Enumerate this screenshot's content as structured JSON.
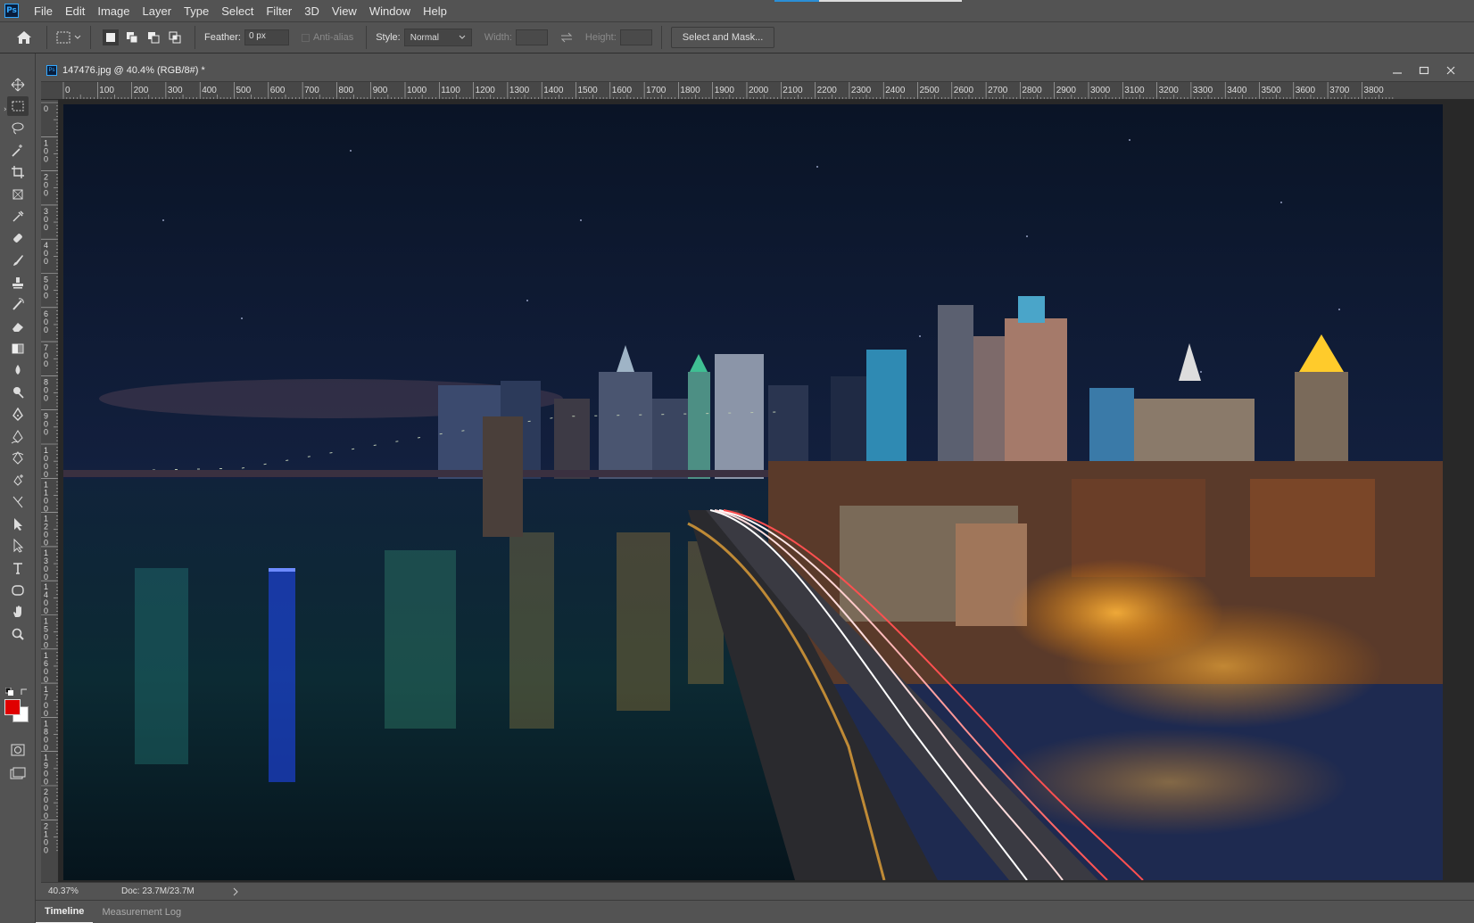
{
  "menubar": {
    "logo": "Ps",
    "items": [
      "File",
      "Edit",
      "Image",
      "Layer",
      "Type",
      "Select",
      "Filter",
      "3D",
      "View",
      "Window",
      "Help"
    ]
  },
  "options": {
    "feather_label": "Feather:",
    "feather_value": "0 px",
    "antialias_label": "Anti-alias",
    "style_label": "Style:",
    "style_value": "Normal",
    "width_label": "Width:",
    "height_label": "Height:",
    "select_mask_label": "Select and Mask..."
  },
  "tools": [
    "move-tool-icon",
    "rect-marquee-icon",
    "lasso-icon",
    "magic-wand-icon",
    "crop-icon",
    "frame-icon",
    "eyedropper-icon",
    "healing-brush-icon",
    "brush-icon",
    "clone-stamp-icon",
    "history-brush-icon",
    "eraser-icon",
    "gradient-icon",
    "blur-icon",
    "dodge-icon",
    "pen-icon",
    "freeform-pen-icon",
    "curvature-pen-icon",
    "add-anchor-icon",
    "convert-point-icon",
    "path-selection-icon",
    "direct-selection-icon",
    "type-icon",
    "shape-icon",
    "hand-icon",
    "zoom-icon"
  ],
  "colors": {
    "foreground": "#e00000",
    "background": "#ffffff",
    "accent": "#31a8ff"
  },
  "document": {
    "title": "147476.jpg @ 40.4% (RGB/8#) *",
    "zoom": "40.37%",
    "doc_size": "Doc: 23.7M/23.7M"
  },
  "ruler_h": [
    "0",
    "100",
    "200",
    "300",
    "400",
    "500",
    "600",
    "700",
    "800",
    "900",
    "1000",
    "1100",
    "1200",
    "1300",
    "1400",
    "1500",
    "1600",
    "1700",
    "1800",
    "1900",
    "2000",
    "2100",
    "2200",
    "2300",
    "2400",
    "2500",
    "2600",
    "2700",
    "2800",
    "2900",
    "3000",
    "3100",
    "3200",
    "3300",
    "3400",
    "3500",
    "3600",
    "3700",
    "3800"
  ],
  "ruler_v": [
    "0",
    "100",
    "200",
    "300",
    "400",
    "500",
    "600",
    "700",
    "800",
    "900",
    "1000",
    "1100",
    "1200",
    "1300",
    "1400",
    "1500",
    "1600",
    "1700",
    "1800",
    "1900",
    "2000",
    "2100"
  ],
  "bottom_tabs": [
    "Timeline",
    "Measurement Log"
  ]
}
